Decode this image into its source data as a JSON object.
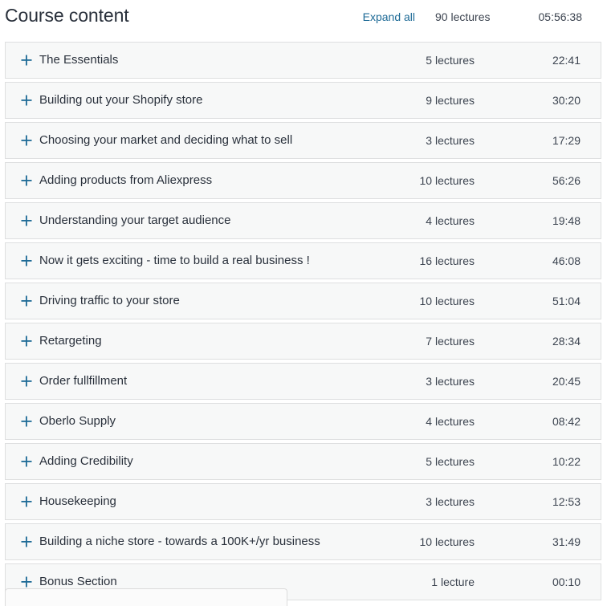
{
  "header": {
    "title": "Course content",
    "expand_all_label": "Expand all",
    "total_lectures": "90 lectures",
    "total_duration": "05:56:38",
    "link_color": "#1d6a96",
    "text_color": "#29303b"
  },
  "icons": {
    "expand_plus": "plus-icon"
  },
  "sections": [
    {
      "title": "The Essentials",
      "lectures": "5 lectures",
      "duration": "22:41"
    },
    {
      "title": "Building out your Shopify store",
      "lectures": "9 lectures",
      "duration": "30:20"
    },
    {
      "title": "Choosing your market and deciding what to sell",
      "lectures": "3 lectures",
      "duration": "17:29"
    },
    {
      "title": "Adding products from Aliexpress",
      "lectures": "10 lectures",
      "duration": "56:26"
    },
    {
      "title": "Understanding your target audience",
      "lectures": "4 lectures",
      "duration": "19:48"
    },
    {
      "title": "Now it gets exciting - time to build a real business !",
      "lectures": "16 lectures",
      "duration": "46:08"
    },
    {
      "title": "Driving traffic to your store",
      "lectures": "10 lectures",
      "duration": "51:04"
    },
    {
      "title": "Retargeting",
      "lectures": "7 lectures",
      "duration": "28:34"
    },
    {
      "title": "Order fullfillment",
      "lectures": "3 lectures",
      "duration": "20:45"
    },
    {
      "title": "Oberlo Supply",
      "lectures": "4 lectures",
      "duration": "08:42"
    },
    {
      "title": "Adding Credibility",
      "lectures": "5 lectures",
      "duration": "10:22"
    },
    {
      "title": "Housekeeping",
      "lectures": "3 lectures",
      "duration": "12:53"
    },
    {
      "title": "Building a niche store - towards a 100K+/yr business",
      "lectures": "10 lectures",
      "duration": "31:49"
    },
    {
      "title": "Bonus Section",
      "lectures": "1 lecture",
      "duration": "00:10"
    }
  ],
  "bottom_panel": {
    "content": ""
  }
}
